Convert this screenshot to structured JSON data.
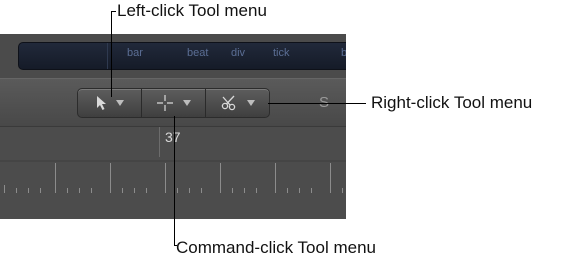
{
  "callouts": {
    "left_click": "Left-click Tool menu",
    "right_click": "Right-click Tool menu",
    "command_click": "Command-click Tool menu"
  },
  "lcd": {
    "bar_label": "bar",
    "beat_label": "beat",
    "div_label": "div",
    "tick_label": "tick",
    "edge_label": "b"
  },
  "toolbar": {
    "left_tool_icon": "pointer-icon",
    "command_tool_icon": "crosshair-icon",
    "right_tool_icon": "scissors-icon",
    "snap_label_fragment": "S"
  },
  "ruler": {
    "bar_number": "37"
  },
  "colors": {
    "panel_background": "#4b4b4b",
    "lcd_background": "#1b2231",
    "lcd_text": "#5b6e94"
  }
}
